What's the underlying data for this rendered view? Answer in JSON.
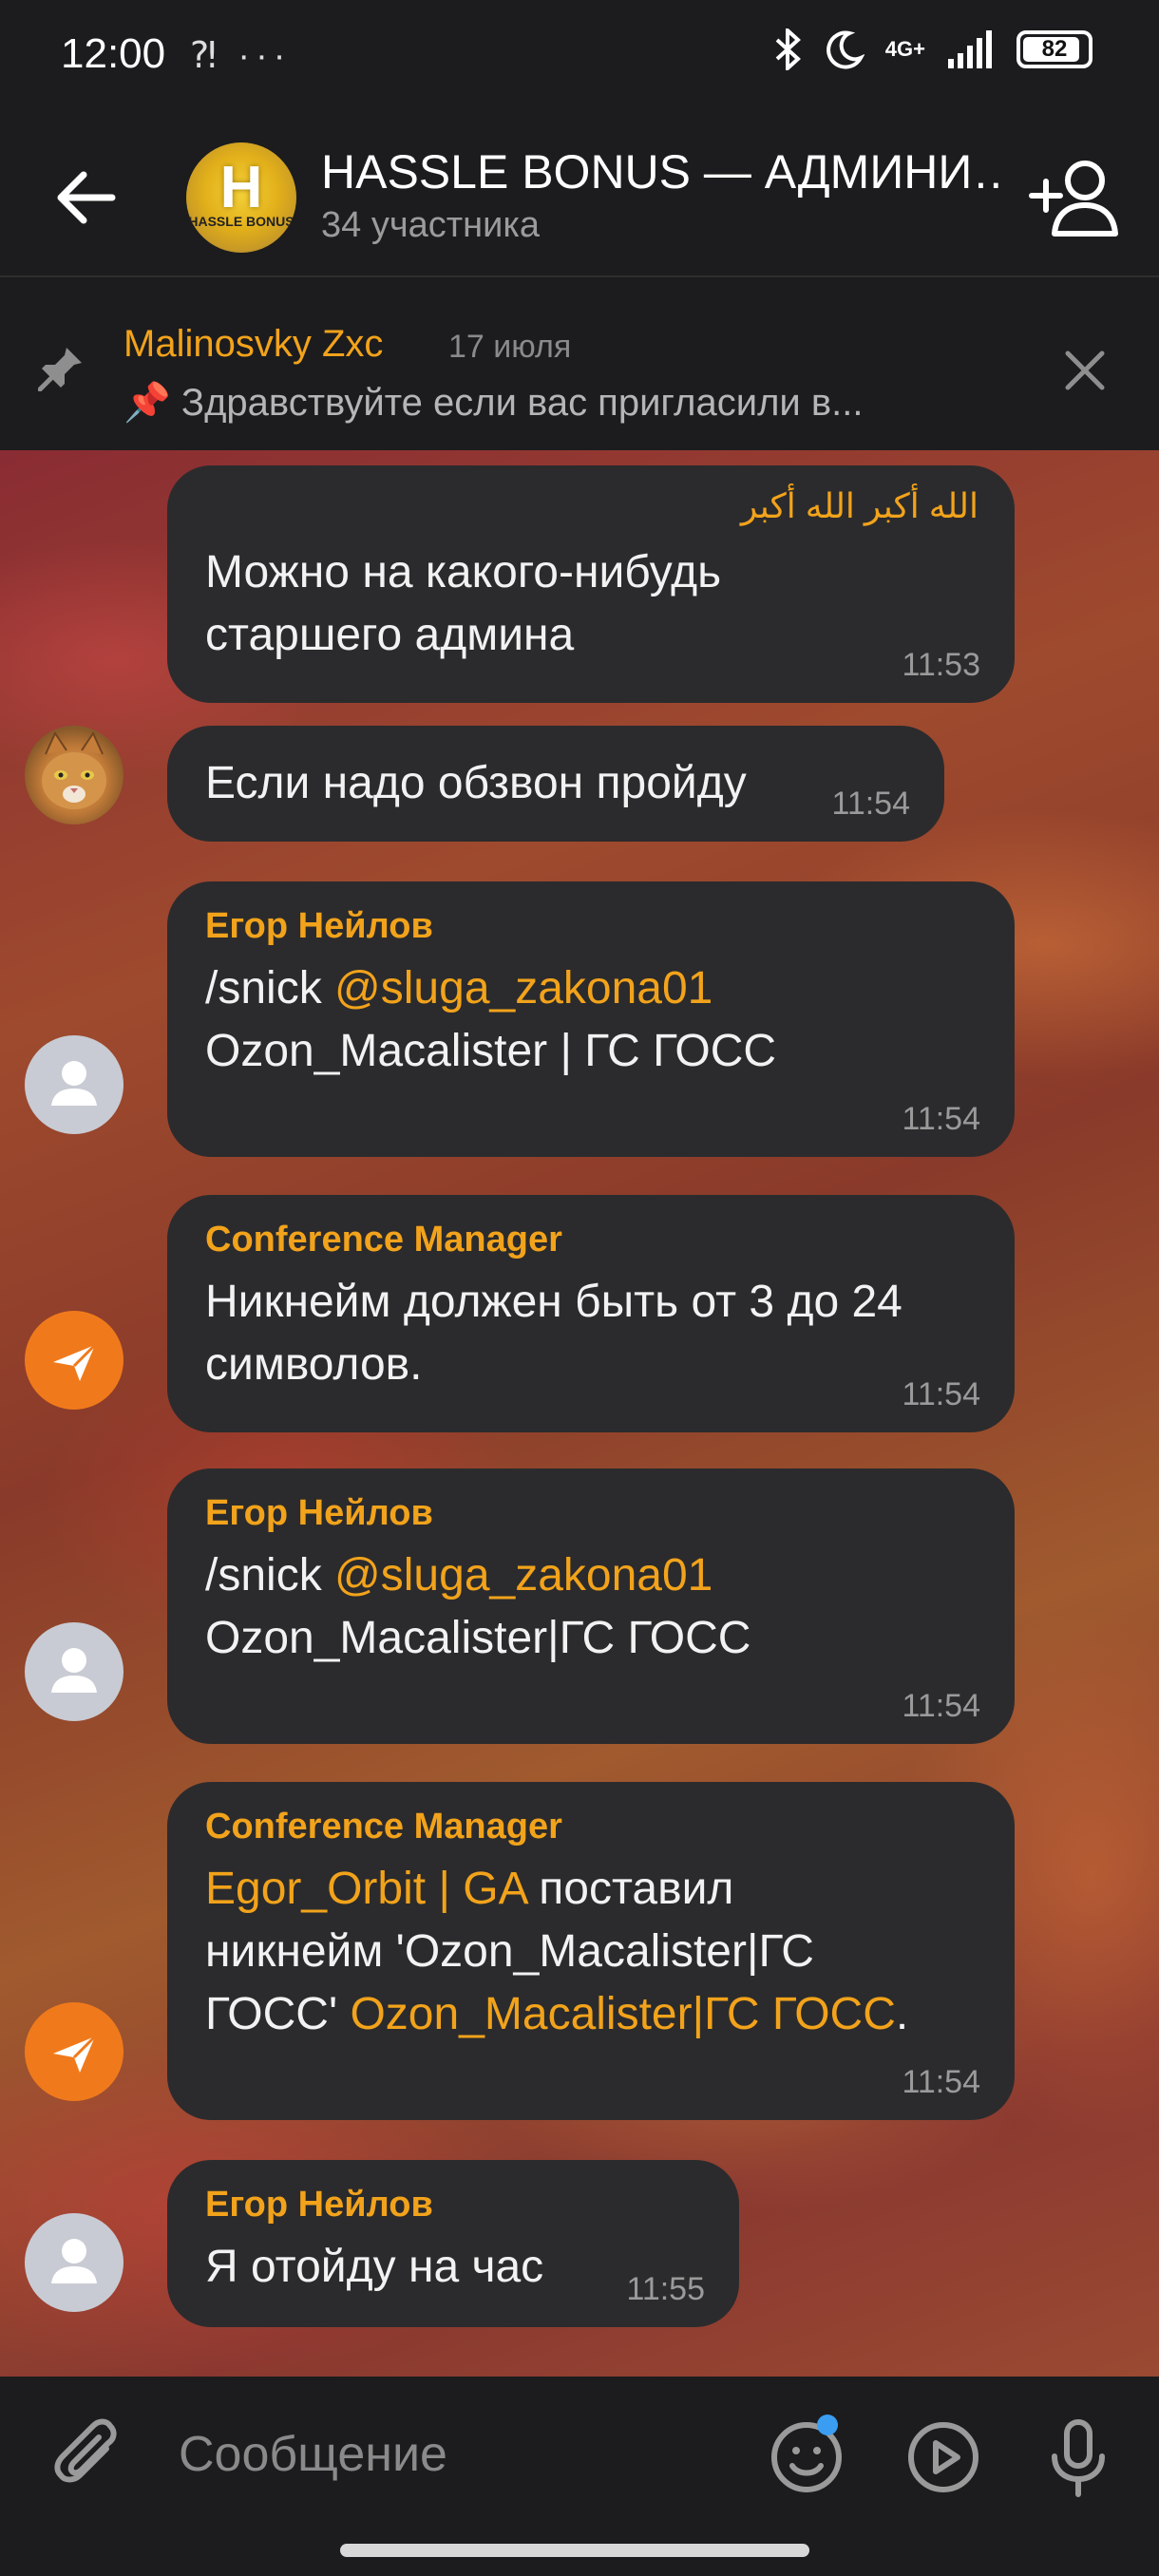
{
  "status_bar": {
    "time": "12:00",
    "left_icons": "⁈ ···",
    "network": "4G+",
    "battery": "82"
  },
  "header": {
    "title": "HASSLE BONUS — АДМИНИ…",
    "subtitle": "34 участника",
    "avatar_letter": "H",
    "avatar_text": "HASSLE BONUS"
  },
  "pinned": {
    "author": "Malinosvky Zxc",
    "date": "17 июля",
    "text": "📌 Здравствуйте если вас пригласили в..."
  },
  "messages": [
    {
      "sender": "الله أكبر الله أكبر",
      "lines": [
        "Можно на какого-нибудь",
        "старшего админа"
      ],
      "time": "11:53"
    },
    {
      "text": "Если надо обзвон пройду",
      "time": "11:54"
    },
    {
      "sender": "Егор Нейлов",
      "line1_cmd": "/snick ",
      "line1_link": "@sluga_zakona01",
      "line2": "Ozon_Macalister | ГС ГОСС",
      "time": "11:54"
    },
    {
      "sender": "Conference Manager",
      "lines": [
        "Никнейм должен быть от 3 до 24",
        "символов."
      ],
      "time": "11:54"
    },
    {
      "sender": "Егор Нейлов",
      "line1_cmd": "/snick ",
      "line1_link": "@sluga_zakona01",
      "line2": "Ozon_Macalister|ГС ГОСС",
      "time": "11:54"
    },
    {
      "sender": "Conference Manager",
      "link1": "Egor_Orbit | GA",
      "text1": " поставил",
      "line2": "никнейм 'Ozon_Macalister|ГС",
      "line3_text": "ГОСС' ",
      "link2": "Ozon_Macalister|ГС ГОСС",
      "line3_end": ".",
      "time": "11:54"
    },
    {
      "sender": "Егор Нейлов",
      "text": "Я отойду на час",
      "time": "11:55"
    }
  ],
  "composer": {
    "placeholder": "Сообщение"
  },
  "colors": {
    "accent": "#f2a31b",
    "bubble": "#2b2b2d",
    "bot_avatar": "#f07a1b",
    "bar": "#1c1c1e"
  }
}
